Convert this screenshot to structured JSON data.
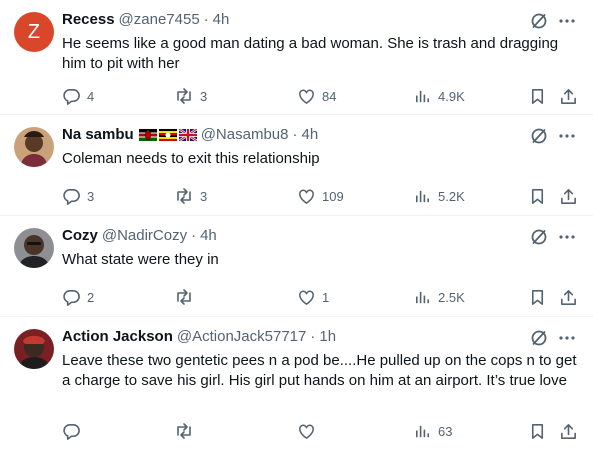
{
  "tweets": [
    {
      "name": "Recess",
      "handle": "@zane7455",
      "time": "4h",
      "avatar_letter": "Z",
      "text": "He seems like a good man dating a bad woman. She is trash and dragging him to pit with her",
      "replies": "4",
      "reposts": "3",
      "likes": "84",
      "views": "4.9K"
    },
    {
      "name": "Na sambu",
      "handle": "@Nasambu8",
      "time": "4h",
      "flags": [
        "kenya-flag",
        "uganda-flag",
        "uk-flag"
      ],
      "text": "Coleman needs to exit this relationship",
      "replies": "3",
      "reposts": "3",
      "likes": "109",
      "views": "5.2K"
    },
    {
      "name": "Cozy",
      "handle": "@NadirCozy",
      "time": "4h",
      "text": "What state were they in",
      "replies": "2",
      "reposts": "",
      "likes": "1",
      "views": "2.5K"
    },
    {
      "name": "Action Jackson",
      "handle": "@ActionJack57717",
      "time": "1h",
      "text": "Leave these two gentetic pees n a pod be....He pulled up on the cops n to get a charge to save his girl. His girl put hands on him at an airport. It’s true love",
      "replies": "",
      "reposts": "",
      "likes": "",
      "views": "63"
    }
  ],
  "separator": "·",
  "colors": {
    "text": "#0f1419",
    "secondary": "#536471",
    "divider": "#eff3f4",
    "avatar_z": "#d9472b"
  },
  "icons": [
    "reply-icon",
    "repost-icon",
    "like-icon",
    "views-icon",
    "bookmark-icon",
    "share-icon",
    "grok-icon",
    "more-icon"
  ]
}
